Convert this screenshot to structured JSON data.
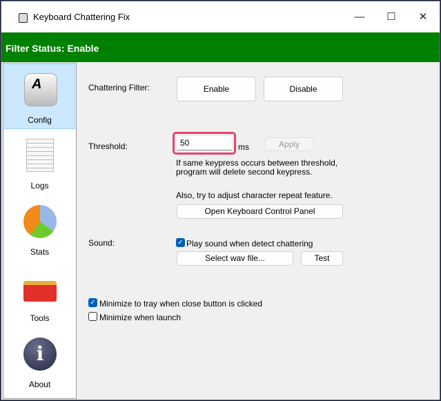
{
  "window": {
    "title": "Keyboard Chattering Fix",
    "minimize": "—",
    "maximize": "☐",
    "close": "✕"
  },
  "status": "Filter Status: Enable",
  "colors": {
    "status_bg": "#008000",
    "highlight": "#e8436a",
    "accent": "#005fb8"
  },
  "sidebar": {
    "items": [
      {
        "label": "Config",
        "icon": "keyboard-key-icon"
      },
      {
        "label": "Logs",
        "icon": "document-icon"
      },
      {
        "label": "Stats",
        "icon": "pie-chart-icon"
      },
      {
        "label": "Tools",
        "icon": "toolbox-icon"
      },
      {
        "label": "About",
        "icon": "info-icon"
      }
    ]
  },
  "config": {
    "filter_label": "Chattering Filter:",
    "enable": "Enable",
    "disable": "Disable",
    "threshold_label": "Threshold:",
    "threshold_value": "50",
    "unit": "ms",
    "apply": "Apply",
    "threshold_help1": "If same keypress occurs between threshold,",
    "threshold_help2": "program will delete second keypress.",
    "repeat_hint": "Also, try to adjust character repeat feature.",
    "open_panel": "Open Keyboard Control Panel",
    "sound_label": "Sound:",
    "play_sound": "Play sound when detect chattering",
    "select_wav": "Select wav file...",
    "test": "Test",
    "tray": "Minimize to tray when close button is clicked",
    "min_launch": "Minimize when launch"
  }
}
